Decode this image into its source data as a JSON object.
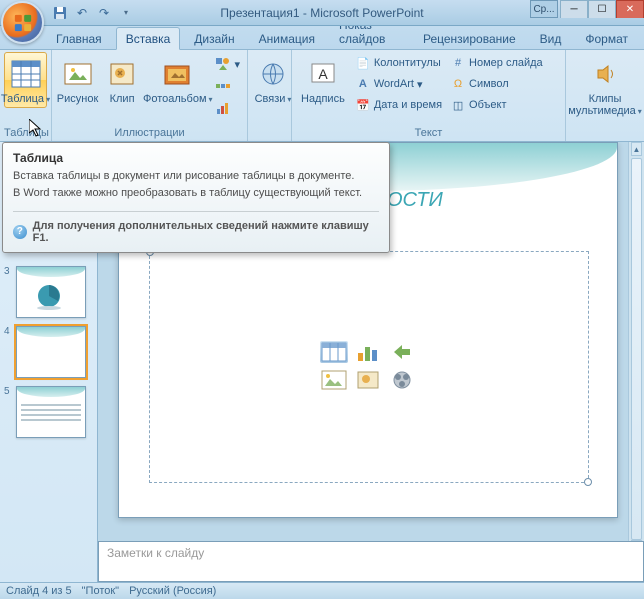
{
  "title": "Презентация1 - Microsoft PowerPoint",
  "qat_combo": "Ср...",
  "tabs": {
    "home": "Главная",
    "insert": "Вставка",
    "design": "Дизайн",
    "animation": "Анимация",
    "slideshow": "Показ слайдов",
    "review": "Рецензирование",
    "view": "Вид",
    "format": "Формат"
  },
  "ribbon": {
    "tables": {
      "button": "Таблица",
      "group": "Таблицы"
    },
    "illustrations": {
      "picture": "Рисунок",
      "clip": "Клип",
      "album": "Фотоальбом",
      "group": "Иллюстрации"
    },
    "links": {
      "button": "Связи",
      "group": ""
    },
    "text": {
      "textbox": "Надпись",
      "headerfooter": "Колонтитулы",
      "wordart": "WordArt",
      "datetime": "Дата и время",
      "slidenum": "Номер слайда",
      "symbol": "Символ",
      "object": "Объект",
      "group": "Текст"
    },
    "media": {
      "button": "Клипы\nмультимедиа",
      "group": ""
    }
  },
  "tooltip": {
    "title": "Таблица",
    "line1": "Вставка таблицы в документ или рисование таблицы в документе.",
    "line2": "В Word также можно преобразовать в таблицу существующий текст.",
    "help": "Для получения дополнительных сведений нажмите клавишу F1."
  },
  "slide": {
    "title_fragment": "ОСТИ"
  },
  "thumbs": {
    "n3": "3",
    "n4": "4",
    "n5": "5"
  },
  "notes_placeholder": "Заметки к слайду",
  "status": {
    "slide": "Слайд 4 из 5",
    "theme": "\"Поток\"",
    "lang": "Русский (Россия)"
  }
}
